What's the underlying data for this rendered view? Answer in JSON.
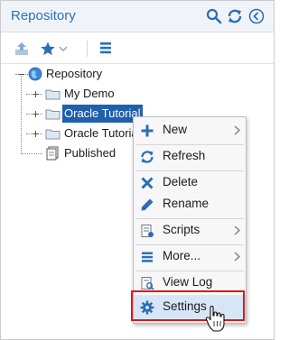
{
  "header": {
    "title": "Repository",
    "icons": [
      "search-icon",
      "refresh-icon",
      "collapse-left-icon"
    ]
  },
  "toolbar": {
    "icons": [
      "upload-icon",
      "favorite-star-icon",
      "chevron-down-icon",
      "menu-icon"
    ]
  },
  "tree": {
    "root": "Repository",
    "items": [
      {
        "label": "My Demo",
        "icon": "folder-icon"
      },
      {
        "label": "Oracle Tutorial",
        "icon": "folder-icon",
        "selected": true
      },
      {
        "label": "Oracle Tutorial",
        "icon": "folder-icon"
      },
      {
        "label": "Published",
        "icon": "published-icon"
      }
    ]
  },
  "context_menu": {
    "items": [
      {
        "label": "New",
        "icon": "plus-icon",
        "submenu": true
      },
      {
        "label": "Refresh",
        "icon": "refresh-icon"
      },
      {
        "label": "Delete",
        "icon": "delete-x-icon"
      },
      {
        "label": "Rename",
        "icon": "pencil-icon"
      },
      {
        "label": "Scripts",
        "icon": "scripts-icon",
        "submenu": true
      },
      {
        "label": "More...",
        "icon": "list-icon",
        "submenu": true
      },
      {
        "label": "View Log",
        "icon": "view-log-icon"
      },
      {
        "label": "Settings",
        "icon": "gear-icon",
        "highlighted": true
      }
    ]
  },
  "colors": {
    "accent": "#2a6fb5",
    "selection": "#1f5fae",
    "highlight_border": "#e01818",
    "menu_background": "#f7f7f7"
  }
}
